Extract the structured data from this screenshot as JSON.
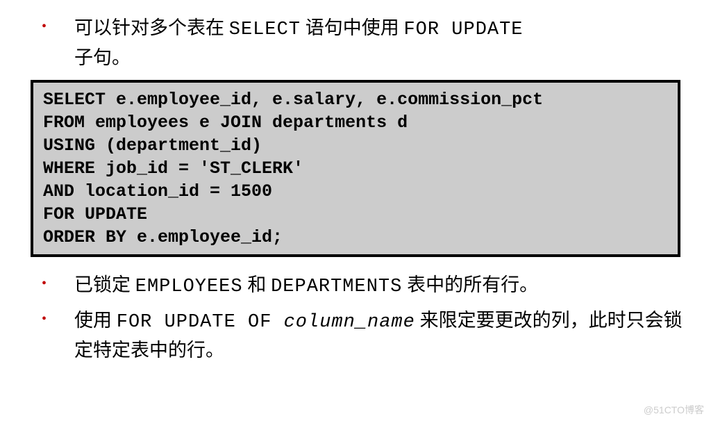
{
  "bullets": {
    "b1_part1": "可以针对多个表在 ",
    "b1_code1": "SELECT",
    "b1_part2": " 语句中使用 ",
    "b1_code2": "FOR UPDATE",
    "b1_part3": "子句。",
    "b2_part1": "已锁定 ",
    "b2_code1": "EMPLOYEES",
    "b2_part2": " 和 ",
    "b2_code2": "DEPARTMENTS",
    "b2_part3": " 表中的所有行。",
    "b3_part1": "使用 ",
    "b3_code1": "FOR UPDATE OF ",
    "b3_code2": "column_name",
    "b3_part2": " 来限定要更改的列，此时只会锁定特定表中的行。"
  },
  "code": "SELECT e.employee_id, e.salary, e.commission_pct\nFROM employees e JOIN departments d\nUSING (department_id)\nWHERE job_id = 'ST_CLERK'\nAND location_id = 1500\nFOR UPDATE\nORDER BY e.employee_id;",
  "watermark": "@51CTO博客",
  "bullet_char": "•"
}
